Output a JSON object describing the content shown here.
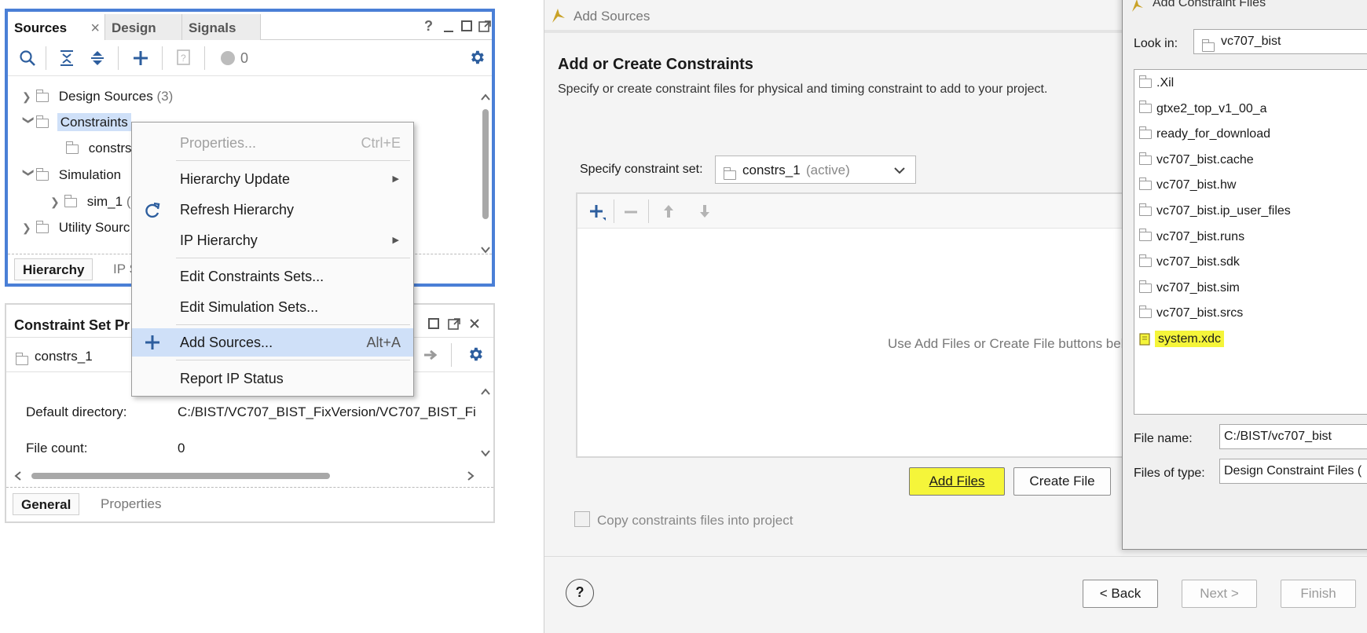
{
  "sources_panel": {
    "tabs": [
      "Sources",
      "Design",
      "Signals"
    ],
    "close_glyph": "×",
    "help_glyph": "?",
    "issue_count": "0",
    "tree": [
      {
        "label": "Design Sources",
        "count": "(3)",
        "expanded": false
      },
      {
        "label": "Constraints",
        "selected": true,
        "expanded": true
      },
      {
        "label": "constrs_",
        "child": true
      },
      {
        "label": "Simulation",
        "expanded": true
      },
      {
        "label": "sim_1",
        "extra": "(",
        "child": true
      },
      {
        "label": "Utility Sourc",
        "expanded": false
      }
    ],
    "bottom_tabs": [
      "Hierarchy",
      "IP S"
    ]
  },
  "context_menu": {
    "items": [
      {
        "label": "Properties...",
        "shortcut": "Ctrl+E",
        "disabled": true
      },
      {
        "label": "Hierarchy Update",
        "submenu": true
      },
      {
        "label": "Refresh Hierarchy",
        "icon": "refresh-icon"
      },
      {
        "label": "IP Hierarchy",
        "submenu": true
      },
      {
        "label": "Edit Constraints Sets..."
      },
      {
        "label": "Edit Simulation Sets..."
      },
      {
        "label": "Add Sources...",
        "shortcut": "Alt+A",
        "icon": "plus-icon",
        "highlighted": true
      },
      {
        "label": "Report IP Status"
      }
    ]
  },
  "cset_panel": {
    "title": "Constraint Set Pr",
    "current_set": "constrs_1",
    "rows": [
      {
        "label": "Default directory:",
        "value": "C:/BIST/VC707_BIST_FixVersion/VC707_BIST_Fi"
      },
      {
        "label": "File count:",
        "value": "0"
      }
    ],
    "bottom_tabs": [
      "General",
      "Properties"
    ]
  },
  "wizard": {
    "title": "Add Sources",
    "heading": "Add or Create Constraints",
    "description": "Specify or create constraint files for physical and timing constraint to add to your project.",
    "constraint_set_label": "Specify constraint set:",
    "constraint_set_value": "constrs_1",
    "constraint_set_state": "(active)",
    "empty_hint": "Use Add Files or Create File buttons belo",
    "add_files": "Add Files",
    "create_file": "Create File",
    "copy_checkbox": "Copy constraints files into project",
    "help": "?",
    "back": "< Back",
    "next": "Next >",
    "finish": "Finish"
  },
  "file_dialog": {
    "title": "Add Constraint Files",
    "look_in_label": "Look in:",
    "look_in_value": "vc707_bist",
    "entries": [
      {
        "name": ".Xil",
        "type": "folder"
      },
      {
        "name": "gtxe2_top_v1_00_a",
        "type": "folder"
      },
      {
        "name": "ready_for_download",
        "type": "folder"
      },
      {
        "name": "vc707_bist.cache",
        "type": "folder"
      },
      {
        "name": "vc707_bist.hw",
        "type": "folder"
      },
      {
        "name": "vc707_bist.ip_user_files",
        "type": "folder"
      },
      {
        "name": "vc707_bist.runs",
        "type": "folder"
      },
      {
        "name": "vc707_bist.sdk",
        "type": "folder"
      },
      {
        "name": "vc707_bist.sim",
        "type": "folder"
      },
      {
        "name": "vc707_bist.srcs",
        "type": "folder"
      },
      {
        "name": "system.xdc",
        "type": "file",
        "highlighted": true
      }
    ],
    "file_name_label": "File name:",
    "file_name_value": "C:/BIST/vc707_bist",
    "files_of_type_label": "Files of type:",
    "files_of_type_value": "Design Constraint Files ("
  },
  "colors": {
    "accent": "#4a7fd6",
    "menu_highlight": "#cfe0f8",
    "marker_highlight": "#f5f53a",
    "icon_blue": "#2d5e9e"
  }
}
